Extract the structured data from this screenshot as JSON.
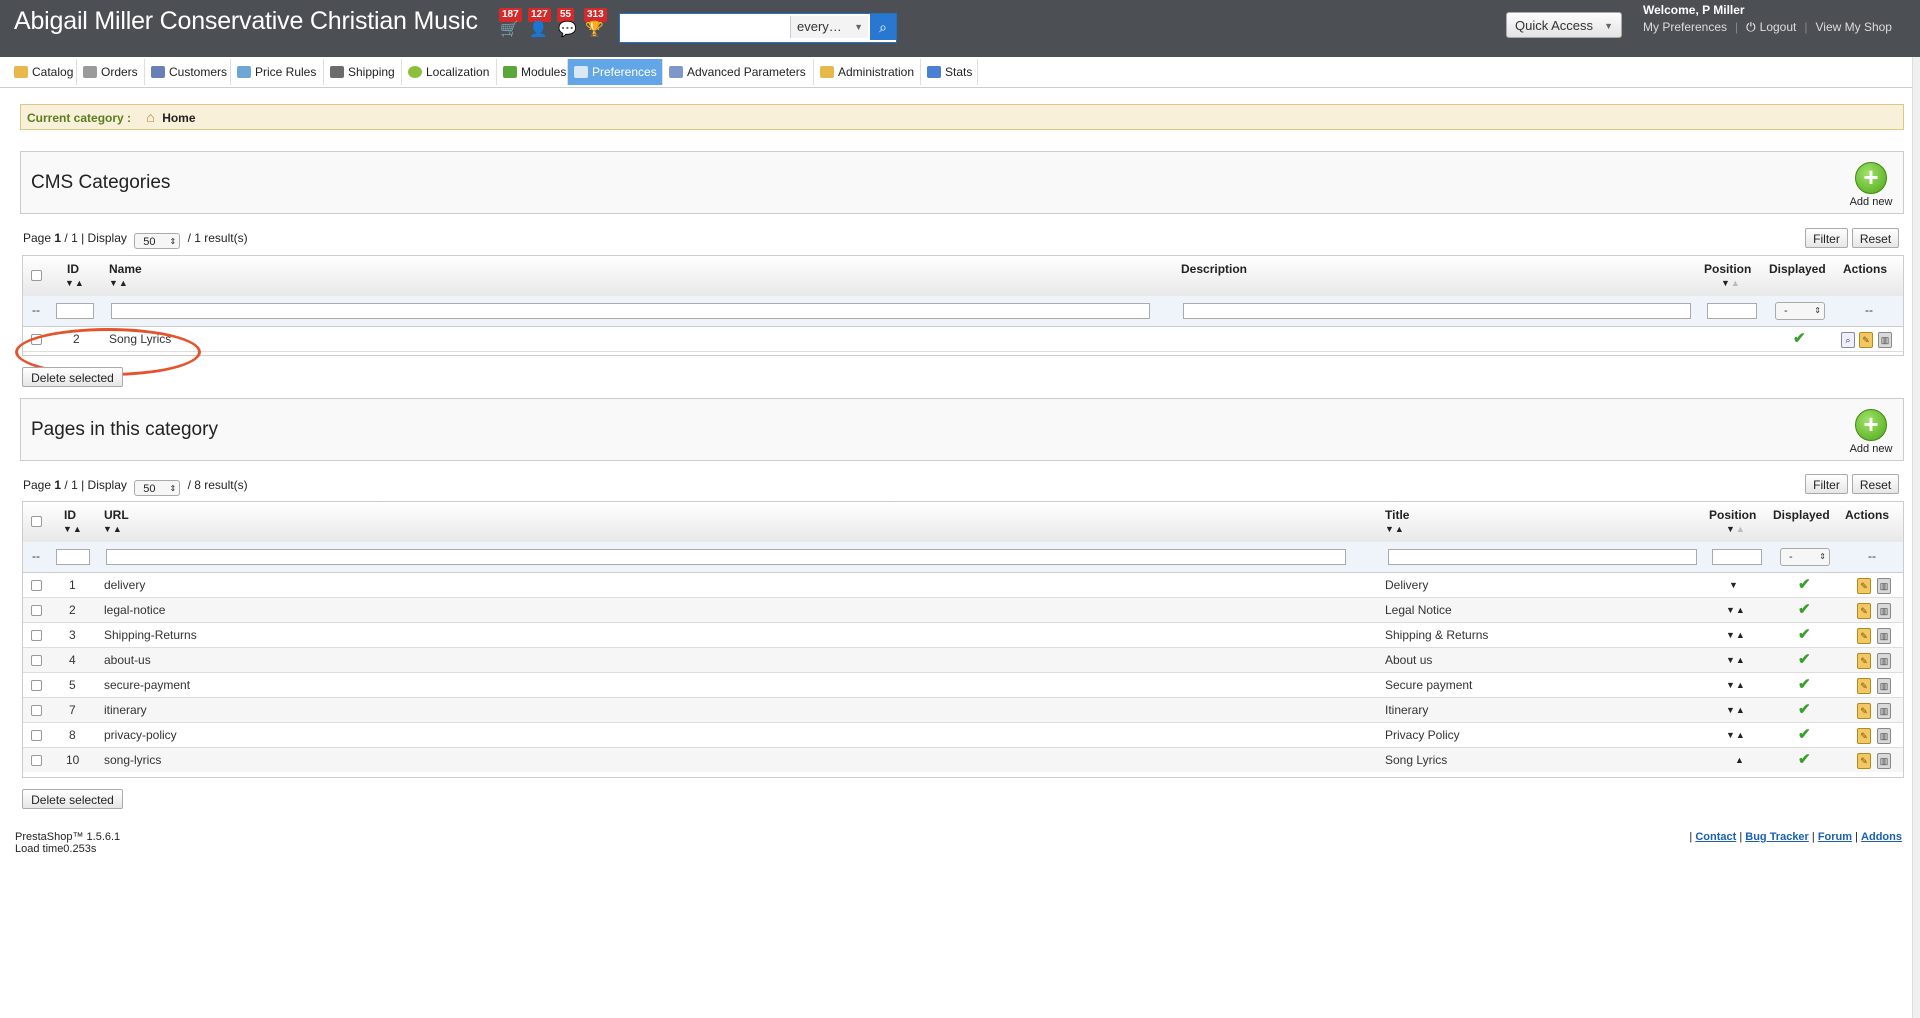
{
  "header": {
    "shop_title": "Abigail Miller Conservative Christian Music",
    "notifications": [
      {
        "icon": "cart-icon",
        "count": "187"
      },
      {
        "icon": "customer-icon",
        "count": "127"
      },
      {
        "icon": "message-icon",
        "count": "55"
      },
      {
        "icon": "trophy-icon",
        "count": "313"
      }
    ],
    "search": {
      "value": "",
      "scope": "every…"
    },
    "quick_access": "Quick Access",
    "welcome": "Welcome, P Miller",
    "links": {
      "preferences": "My Preferences",
      "logout": "Logout",
      "view_shop": "View My Shop"
    }
  },
  "tabs": [
    {
      "label": "Catalog",
      "icon": "folder-icon",
      "color": "#e8b94a"
    },
    {
      "label": "Orders",
      "icon": "cart-icon",
      "color": "#9a9a9a"
    },
    {
      "label": "Customers",
      "icon": "customer-icon",
      "color": "#6a7fb5"
    },
    {
      "label": "Price Rules",
      "icon": "price-tag-icon",
      "color": "#6fa6d8"
    },
    {
      "label": "Shipping",
      "icon": "truck-icon",
      "color": "#6b6b6b"
    },
    {
      "label": "Localization",
      "icon": "globe-icon",
      "color": "#8fbf3a"
    },
    {
      "label": "Modules",
      "icon": "puzzle-icon",
      "color": "#5aa63a"
    },
    {
      "label": "Preferences",
      "icon": "preferences-icon",
      "color": "#d9e8f7"
    },
    {
      "label": "Advanced Parameters",
      "icon": "wrench-icon",
      "color": "#7f97c9"
    },
    {
      "label": "Administration",
      "icon": "key-icon",
      "color": "#e8b94a"
    },
    {
      "label": "Stats",
      "icon": "chart-icon",
      "color": "#4a7fd4"
    }
  ],
  "breadcrumb": {
    "label": "Current category :",
    "home": "Home"
  },
  "cms_categories": {
    "title": "CMS Categories",
    "add_new": "Add new",
    "pager": {
      "page_prefix": "Page",
      "page": "1",
      "pages": "/ 1 | Display",
      "per_page": "50",
      "results": "/ 1 result(s)"
    },
    "filter": "Filter",
    "reset": "Reset",
    "columns": {
      "id": "ID",
      "name": "Name",
      "description": "Description",
      "position": "Position",
      "displayed": "Displayed",
      "actions": "Actions"
    },
    "filter_dash": "--",
    "select_value": "-",
    "rows": [
      {
        "id": "2",
        "name": "Song Lyrics",
        "displayed": "✔"
      }
    ],
    "delete_selected": "Delete selected"
  },
  "pages": {
    "title": "Pages in this category",
    "add_new": "Add new",
    "pager": {
      "page_prefix": "Page",
      "page": "1",
      "pages": "/ 1 | Display",
      "per_page": "50",
      "results": "/ 8 result(s)"
    },
    "filter": "Filter",
    "reset": "Reset",
    "columns": {
      "id": "ID",
      "url": "URL",
      "title": "Title",
      "position": "Position",
      "displayed": "Displayed",
      "actions": "Actions"
    },
    "filter_dash": "--",
    "select_value": "-",
    "rows": [
      {
        "id": "1",
        "url": "delivery",
        "title": "Delivery",
        "arrows": "▼"
      },
      {
        "id": "2",
        "url": "legal-notice",
        "title": "Legal Notice",
        "arrows": "▼▲"
      },
      {
        "id": "3",
        "url": "Shipping-Returns",
        "title": "Shipping & Returns",
        "arrows": "▼▲"
      },
      {
        "id": "4",
        "url": "about-us",
        "title": "About us",
        "arrows": "▼▲"
      },
      {
        "id": "5",
        "url": "secure-payment",
        "title": "Secure payment",
        "arrows": "▼▲"
      },
      {
        "id": "7",
        "url": "itinerary",
        "title": "Itinerary",
        "arrows": "▼▲"
      },
      {
        "id": "8",
        "url": "privacy-policy",
        "title": "Privacy Policy",
        "arrows": "▼▲"
      },
      {
        "id": "10",
        "url": "song-lyrics",
        "title": "Song Lyrics",
        "arrows": "▲"
      }
    ],
    "delete_selected": "Delete selected"
  },
  "footer": {
    "version": "PrestaShop™ 1.5.6.1",
    "load_time": "Load time0.253s",
    "links": [
      "Contact",
      "Bug Tracker",
      "Forum",
      "Addons"
    ]
  }
}
